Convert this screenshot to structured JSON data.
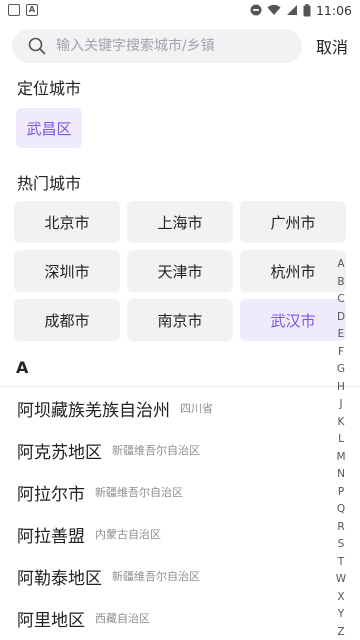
{
  "status_bar": {
    "time": "11:06",
    "icons": [
      "notification-square-icon",
      "a-square-icon",
      "dnd-icon",
      "wifi-icon",
      "signal-icon",
      "battery-icon"
    ]
  },
  "search": {
    "placeholder": "输入关键字搜索城市/乡镇",
    "value": "",
    "cancel_label": "取消"
  },
  "location": {
    "title": "定位城市",
    "city": "武昌区"
  },
  "hot": {
    "title": "热门城市",
    "cities": [
      "北京市",
      "上海市",
      "广州市",
      "深圳市",
      "天津市",
      "杭州市",
      "成都市",
      "南京市",
      "武汉市"
    ],
    "selected": "武汉市"
  },
  "list": {
    "letter": "A",
    "cities": [
      {
        "name": "阿坝藏族羌族自治州",
        "province": "四川省"
      },
      {
        "name": "阿克苏地区",
        "province": "新疆维吾尔自治区"
      },
      {
        "name": "阿拉尔市",
        "province": "新疆维吾尔自治区"
      },
      {
        "name": "阿拉善盟",
        "province": "内蒙古自治区"
      },
      {
        "name": "阿勒泰地区",
        "province": "新疆维吾尔自治区"
      },
      {
        "name": "阿里地区",
        "province": "西藏自治区"
      }
    ]
  },
  "index": [
    "A",
    "B",
    "C",
    "D",
    "E",
    "F",
    "G",
    "H",
    "J",
    "K",
    "L",
    "M",
    "N",
    "P",
    "Q",
    "R",
    "S",
    "T",
    "W",
    "X",
    "Y",
    "Z"
  ],
  "colors": {
    "accent": "#7a58e0",
    "accent_bg": "#efeafc",
    "chip_bg": "#f1f2f4"
  }
}
